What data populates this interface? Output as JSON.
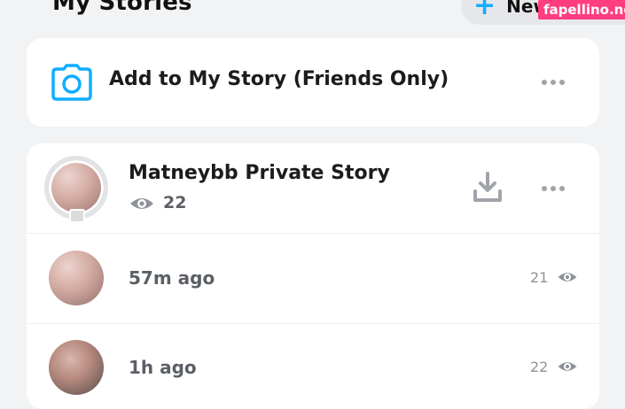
{
  "header": {
    "title": "My Stories",
    "new_label": "New"
  },
  "watermark": "fapellino.net",
  "add_story": {
    "label": "Add to My Story (Friends Only)",
    "icon": "camera-icon"
  },
  "private_story": {
    "name": "Matneybb Private Story",
    "views": "22"
  },
  "snaps": [
    {
      "time": "57m ago",
      "views": "21"
    },
    {
      "time": "1h ago",
      "views": "22"
    }
  ],
  "colors": {
    "accent": "#0fadff",
    "background": "#f2f3f5",
    "card": "#ffffff"
  }
}
